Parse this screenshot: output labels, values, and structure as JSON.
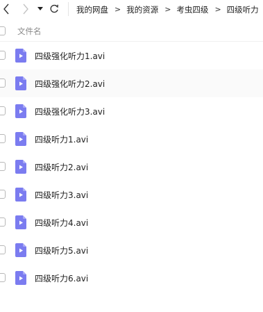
{
  "colors": {
    "accent": "#7b7cf0",
    "row_hover": "#fafafa",
    "divider": "#f0f0f0"
  },
  "breadcrumb": {
    "items": [
      "我的网盘",
      "我的资源",
      "考虫四级",
      "四级听力"
    ],
    "separator": ">"
  },
  "header": {
    "name_label": "文件名"
  },
  "files": [
    {
      "name": "四级强化听力1.avi",
      "icon": "video-file-icon"
    },
    {
      "name": "四级强化听力2.avi",
      "icon": "video-file-icon"
    },
    {
      "name": "四级强化听力3.avi",
      "icon": "video-file-icon"
    },
    {
      "name": "四级听力1.avi",
      "icon": "video-file-icon"
    },
    {
      "name": "四级听力2.avi",
      "icon": "video-file-icon"
    },
    {
      "name": "四级听力3.avi",
      "icon": "video-file-icon"
    },
    {
      "name": "四级听力4.avi",
      "icon": "video-file-icon"
    },
    {
      "name": "四级听力5.avi",
      "icon": "video-file-icon"
    },
    {
      "name": "四级听力6.avi",
      "icon": "video-file-icon"
    }
  ]
}
